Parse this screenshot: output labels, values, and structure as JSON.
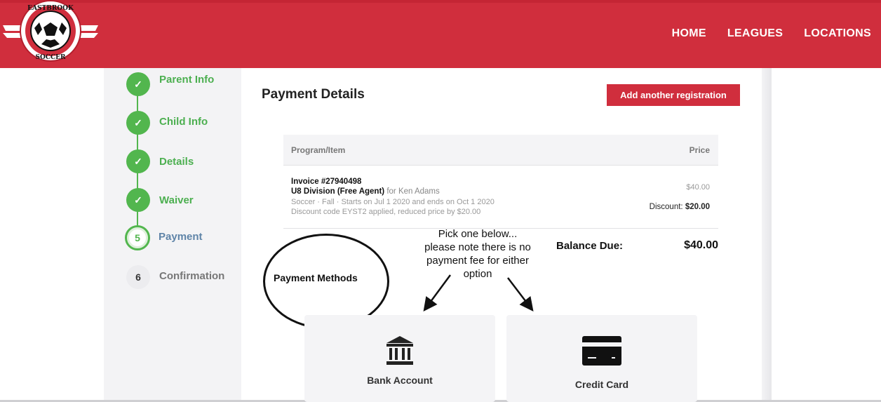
{
  "header": {
    "logo": {
      "text_top": "EASTBROOK",
      "text_bottom": "SOCCER",
      "icon": "soccer-ball-logo"
    },
    "nav": [
      {
        "label": "HOME"
      },
      {
        "label": "LEAGUES"
      },
      {
        "label": "LOCATIONS"
      }
    ]
  },
  "stepper": {
    "steps": [
      {
        "label": "Parent Info",
        "status": "done",
        "marker": "✓"
      },
      {
        "label": "Child Info",
        "status": "done",
        "marker": "✓"
      },
      {
        "label": "Details",
        "status": "done",
        "marker": "✓"
      },
      {
        "label": "Waiver",
        "status": "done",
        "marker": "✓"
      },
      {
        "label": "Payment",
        "status": "active",
        "marker": "5"
      },
      {
        "label": "Confirmation",
        "status": "pending",
        "marker": "6"
      }
    ]
  },
  "main": {
    "title": "Payment Details",
    "add_button": "Add another registration",
    "table": {
      "headers": [
        "Program/Item",
        "Price"
      ],
      "row": {
        "invoice": "Invoice #27940498",
        "division": "U8 Division (Free Agent)",
        "for_text": "for Ken Adams",
        "meta": "Soccer · Fall · Starts on Jul 1 2020 and ends on Oct 1 2020",
        "discount_note": "Discount code EYST2 applied, reduced price by $20.00",
        "price": "$40.00",
        "discount_label": "Discount:",
        "discount_value": "$20.00"
      }
    },
    "balance_label": "Balance Due:",
    "balance_value": "$40.00"
  },
  "annotation": {
    "note_lines": [
      "Pick one below...",
      "please note there is no",
      "payment fee for either",
      "option"
    ],
    "circled_label": "Payment Methods"
  },
  "methods": [
    {
      "label": "Bank Account",
      "icon": "bank-icon"
    },
    {
      "label": "Credit Card",
      "icon": "credit-card-icon"
    }
  ],
  "colors": {
    "brand_red": "#d02e3d",
    "step_green": "#52b64e",
    "active_step_text": "#5f84a8"
  }
}
